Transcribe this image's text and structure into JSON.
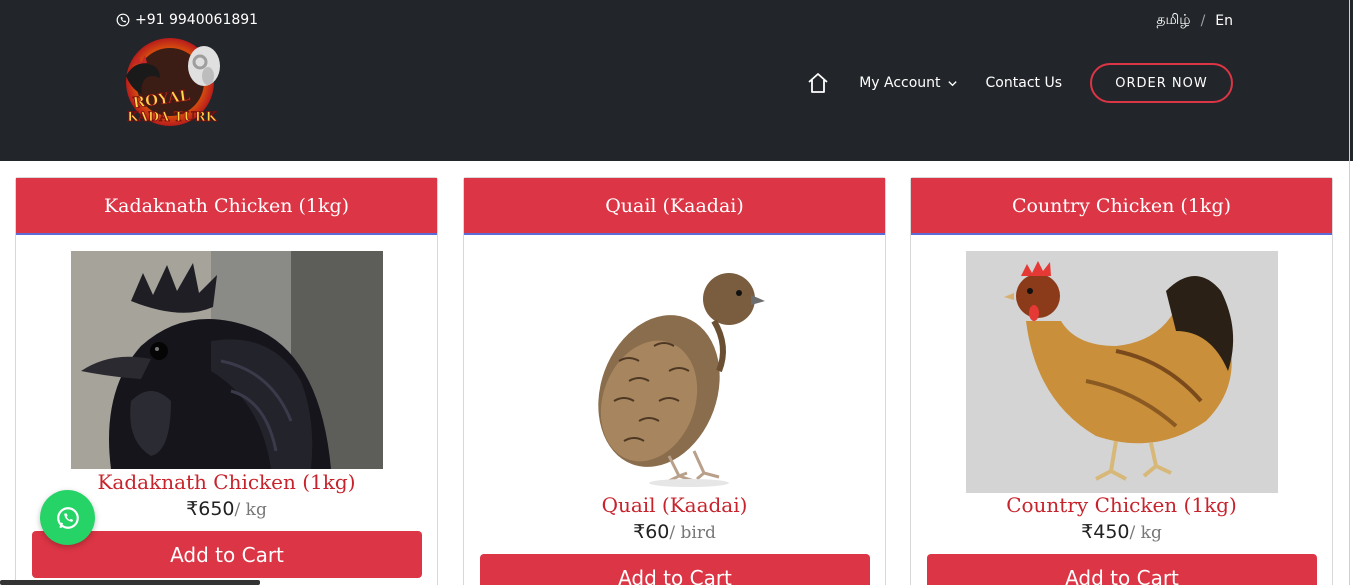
{
  "header": {
    "phone": "+91 9940061891",
    "lang_tamil": "தமிழ்",
    "lang_sep": "/",
    "lang_en": "En",
    "logo_text_line1": "ROYAL",
    "logo_text_line2": "KADA TURK",
    "nav": {
      "home_icon": "home-icon",
      "my_account": "My Account",
      "contact_us": "Contact Us",
      "order_now": "ORDER NOW"
    }
  },
  "products": [
    {
      "header": "Kadaknath Chicken (1kg)",
      "name": "Kadaknath Chicken (1kg)",
      "price": "₹650",
      "unit": "/ kg",
      "button": "Add to Cart",
      "image": "black-rooster"
    },
    {
      "header": "Quail (Kaadai)",
      "name": "Quail (Kaadai)",
      "price": "₹60",
      "unit": "/ bird",
      "button": "Add to Cart",
      "image": "quail"
    },
    {
      "header": "Country Chicken (1kg)",
      "name": "Country Chicken (1kg)",
      "price": "₹450",
      "unit": "/ kg",
      "button": "Add to Cart",
      "image": "brown-hen"
    }
  ],
  "colors": {
    "header_bg": "#222529",
    "accent": "#dc3545",
    "whatsapp": "#25d366"
  }
}
